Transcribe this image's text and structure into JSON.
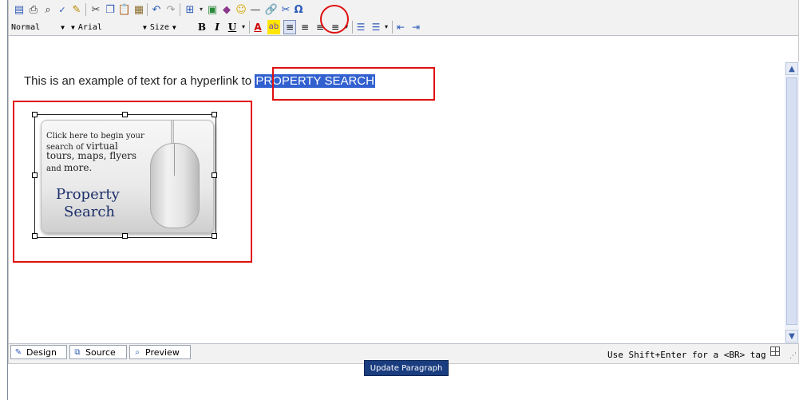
{
  "toolbar": {
    "format_value": "Normal",
    "font_value": "Arial",
    "size_value": "Size",
    "bold": "B",
    "italic": "I",
    "underline": "U",
    "special_char": "Ω"
  },
  "content": {
    "text_before": "This is an example of text for a hyperlink to ",
    "selected_text": "PROPERTY SEARCH",
    "image": {
      "line1": "Click here to begin your",
      "line2_small": "search of ",
      "line2_big": "virtual",
      "line3": "tours, maps, flyers",
      "line4_small": "and ",
      "line4_big": "more.",
      "title1": "Property",
      "title2": "Search"
    }
  },
  "bottom": {
    "tabs": [
      "Design",
      "Source",
      "Preview"
    ],
    "hint": "Use Shift+Enter for a <BR> tag"
  },
  "update_button": "Update Paragraph",
  "colors": {
    "selection": "#3160cf",
    "annotation": "#e01010",
    "update_button_bg": "#1a3d80"
  }
}
